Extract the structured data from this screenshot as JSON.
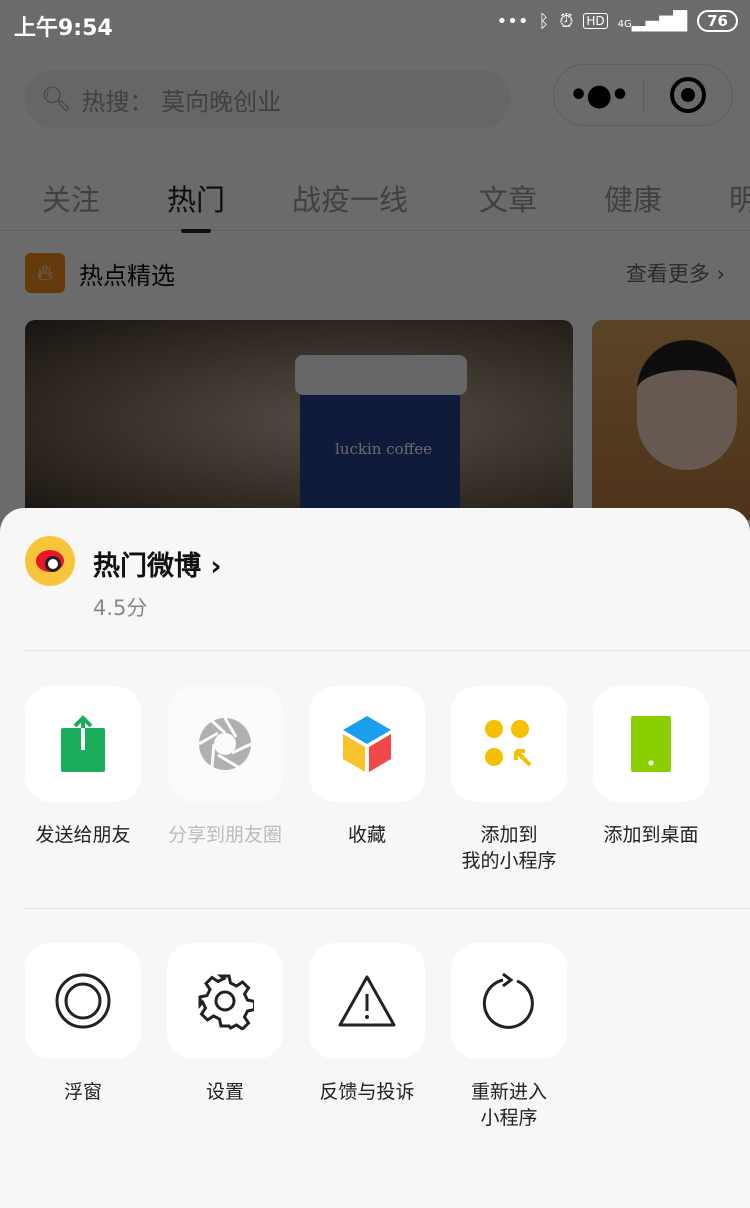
{
  "status": {
    "time": "上午9:54",
    "battery": "76",
    "network": "4G"
  },
  "search": {
    "placeholder": "热搜：  莫向晚创业"
  },
  "tabs": [
    "关注",
    "热门",
    "战疫一线",
    "文章",
    "健康",
    "明"
  ],
  "active_tab": "热门",
  "section": {
    "title": "热点精选",
    "more": "查看更多 ›"
  },
  "card": {
    "text": "luckin coffee"
  },
  "sheet": {
    "app_name": "热门微博 ›",
    "score": "4.5分",
    "row1": [
      {
        "label": "发送给朋友",
        "icon": "share-to-friend-icon",
        "color": "#1aad5b"
      },
      {
        "label": "分享到朋友圈",
        "icon": "moments-icon",
        "color": "#b0b0b0",
        "disabled": true
      },
      {
        "label": "收藏",
        "icon": "favorite-cube-icon"
      },
      {
        "label": "添加到\n我的小程序",
        "icon": "add-mini-program-icon",
        "color": "#f5c000"
      },
      {
        "label": "添加到桌面",
        "icon": "add-to-desktop-icon",
        "color": "#8ccf00"
      }
    ],
    "row2": [
      {
        "label": "浮窗",
        "icon": "floating-window-icon"
      },
      {
        "label": "设置",
        "icon": "settings-gear-icon"
      },
      {
        "label": "反馈与投诉",
        "icon": "warning-icon"
      },
      {
        "label": "重新进入\n小程序",
        "icon": "reload-icon"
      }
    ]
  }
}
